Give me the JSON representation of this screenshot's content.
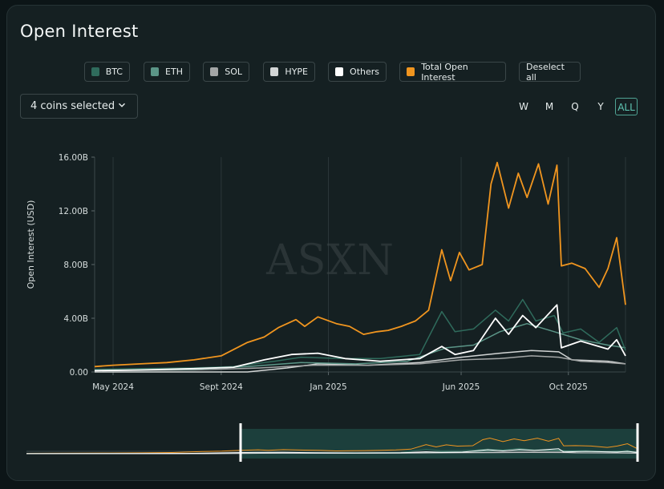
{
  "title": "Open Interest",
  "legend": [
    {
      "label": "BTC",
      "color": "#2f6b5c",
      "icon": "square-swatch"
    },
    {
      "label": "ETH",
      "color": "#5b9587",
      "icon": "square-swatch"
    },
    {
      "label": "SOL",
      "color": "#a3a6a6",
      "icon": "square-swatch"
    },
    {
      "label": "HYPE",
      "color": "#d2d5d5",
      "icon": "square-swatch"
    },
    {
      "label": "Others",
      "color": "#ffffff",
      "icon": "square-swatch"
    },
    {
      "label": "Total Open Interest",
      "color": "#f0951f",
      "icon": "square-swatch"
    }
  ],
  "deselect_label": "Deselect all",
  "coin_select": {
    "label": "4 coins selected",
    "icon": "chevron-down-icon"
  },
  "ranges": [
    "W",
    "M",
    "Q",
    "Y",
    "ALL"
  ],
  "active_range": "ALL",
  "watermark": "ASXN",
  "chart_data": {
    "type": "line",
    "ylabel": "Open Interest (USD)",
    "y_ticks": [
      "16.00B",
      "12.00B",
      "8.00B",
      "4.00B",
      "0.00"
    ],
    "ylim": [
      0,
      16
    ],
    "x_range": [
      "2024-04-10",
      "2025-12-05"
    ],
    "x_ticks": [
      {
        "date": "2024-05-01",
        "label": "May 2024"
      },
      {
        "date": "2024-09-01",
        "label": "Sept 2024"
      },
      {
        "date": "2025-01-01",
        "label": "Jan 2025"
      },
      {
        "date": "2025-06-01",
        "label": "Jun 2025"
      },
      {
        "date": "2025-10-01",
        "label": "Oct 2025"
      }
    ],
    "grid": "vertical",
    "series": [
      {
        "name": "Total Open Interest",
        "color": "#f0951f",
        "values": [
          [
            "2024-04-10",
            0.4
          ],
          [
            "2024-05-01",
            0.5
          ],
          [
            "2024-06-01",
            0.6
          ],
          [
            "2024-07-01",
            0.7
          ],
          [
            "2024-08-01",
            0.9
          ],
          [
            "2024-09-01",
            1.2
          ],
          [
            "2024-10-01",
            2.2
          ],
          [
            "2024-10-20",
            2.6
          ],
          [
            "2024-11-05",
            3.3
          ],
          [
            "2024-11-25",
            3.9
          ],
          [
            "2024-12-05",
            3.4
          ],
          [
            "2024-12-20",
            4.1
          ],
          [
            "2025-01-10",
            3.6
          ],
          [
            "2025-01-25",
            3.4
          ],
          [
            "2025-02-10",
            2.8
          ],
          [
            "2025-02-25",
            3.0
          ],
          [
            "2025-03-10",
            3.1
          ],
          [
            "2025-03-25",
            3.4
          ],
          [
            "2025-04-10",
            3.8
          ],
          [
            "2025-04-25",
            4.6
          ],
          [
            "2025-05-10",
            9.1
          ],
          [
            "2025-05-20",
            6.8
          ],
          [
            "2025-05-30",
            8.9
          ],
          [
            "2025-06-10",
            7.6
          ],
          [
            "2025-06-25",
            8.0
          ],
          [
            "2025-07-05",
            14.0
          ],
          [
            "2025-07-12",
            15.6
          ],
          [
            "2025-07-25",
            12.2
          ],
          [
            "2025-08-05",
            14.8
          ],
          [
            "2025-08-15",
            13.0
          ],
          [
            "2025-08-28",
            15.5
          ],
          [
            "2025-09-08",
            12.5
          ],
          [
            "2025-09-18",
            15.4
          ],
          [
            "2025-09-23",
            7.9
          ],
          [
            "2025-10-05",
            8.1
          ],
          [
            "2025-10-20",
            7.7
          ],
          [
            "2025-11-05",
            6.3
          ],
          [
            "2025-11-15",
            7.7
          ],
          [
            "2025-11-25",
            10.0
          ],
          [
            "2025-12-05",
            5.0
          ]
        ]
      },
      {
        "name": "BTC",
        "color": "#2f6b5c",
        "values": [
          [
            "2024-04-10",
            0.2
          ],
          [
            "2024-06-01",
            0.25
          ],
          [
            "2024-08-01",
            0.3
          ],
          [
            "2024-09-15",
            0.4
          ],
          [
            "2024-11-01",
            0.8
          ],
          [
            "2024-12-01",
            1.1
          ],
          [
            "2025-01-15",
            1.0
          ],
          [
            "2025-03-01",
            1.0
          ],
          [
            "2025-04-15",
            1.3
          ],
          [
            "2025-05-10",
            4.5
          ],
          [
            "2025-05-25",
            3.0
          ],
          [
            "2025-06-15",
            3.2
          ],
          [
            "2025-07-10",
            4.6
          ],
          [
            "2025-07-25",
            3.8
          ],
          [
            "2025-08-10",
            5.4
          ],
          [
            "2025-08-25",
            3.8
          ],
          [
            "2025-09-15",
            4.2
          ],
          [
            "2025-09-25",
            2.9
          ],
          [
            "2025-10-15",
            3.2
          ],
          [
            "2025-11-05",
            2.2
          ],
          [
            "2025-11-25",
            3.3
          ],
          [
            "2025-12-05",
            1.6
          ]
        ]
      },
      {
        "name": "ETH",
        "color": "#5b9587",
        "values": [
          [
            "2024-04-10",
            0.1
          ],
          [
            "2024-08-01",
            0.2
          ],
          [
            "2024-10-01",
            0.4
          ],
          [
            "2024-12-01",
            0.7
          ],
          [
            "2025-02-01",
            0.6
          ],
          [
            "2025-04-01",
            0.8
          ],
          [
            "2025-05-15",
            1.8
          ],
          [
            "2025-06-15",
            2.0
          ],
          [
            "2025-07-15",
            3.0
          ],
          [
            "2025-08-15",
            3.6
          ],
          [
            "2025-09-15",
            3.0
          ],
          [
            "2025-10-15",
            2.4
          ],
          [
            "2025-11-15",
            2.0
          ],
          [
            "2025-12-05",
            1.8
          ]
        ]
      },
      {
        "name": "SOL",
        "color": "#a3a6a6",
        "values": [
          [
            "2024-04-10",
            0.1
          ],
          [
            "2024-08-01",
            0.15
          ],
          [
            "2024-10-15",
            0.3
          ],
          [
            "2024-12-15",
            0.5
          ],
          [
            "2025-02-15",
            0.5
          ],
          [
            "2025-04-15",
            0.6
          ],
          [
            "2025-06-01",
            0.9
          ],
          [
            "2025-07-15",
            1.0
          ],
          [
            "2025-08-20",
            1.2
          ],
          [
            "2025-09-20",
            1.1
          ],
          [
            "2025-10-15",
            0.8
          ],
          [
            "2025-11-15",
            0.7
          ],
          [
            "2025-12-05",
            0.6
          ]
        ]
      },
      {
        "name": "HYPE",
        "color": "#d2d5d5",
        "values": [
          [
            "2024-04-10",
            0.0
          ],
          [
            "2024-10-01",
            0.0
          ],
          [
            "2024-11-15",
            0.3
          ],
          [
            "2024-12-20",
            0.6
          ],
          [
            "2025-02-15",
            0.5
          ],
          [
            "2025-04-15",
            0.7
          ],
          [
            "2025-06-01",
            1.1
          ],
          [
            "2025-07-15",
            1.4
          ],
          [
            "2025-08-20",
            1.6
          ],
          [
            "2025-09-20",
            1.5
          ],
          [
            "2025-10-05",
            0.9
          ],
          [
            "2025-11-15",
            0.8
          ],
          [
            "2025-12-05",
            0.6
          ]
        ]
      },
      {
        "name": "Others",
        "color": "#ffffff",
        "values": [
          [
            "2024-04-10",
            0.1
          ],
          [
            "2024-06-01",
            0.15
          ],
          [
            "2024-08-01",
            0.25
          ],
          [
            "2024-09-15",
            0.35
          ],
          [
            "2024-10-20",
            0.9
          ],
          [
            "2024-11-20",
            1.3
          ],
          [
            "2024-12-20",
            1.4
          ],
          [
            "2025-01-20",
            1.0
          ],
          [
            "2025-03-01",
            0.8
          ],
          [
            "2025-04-15",
            1.0
          ],
          [
            "2025-05-10",
            1.9
          ],
          [
            "2025-05-25",
            1.3
          ],
          [
            "2025-06-15",
            1.6
          ],
          [
            "2025-07-10",
            4.0
          ],
          [
            "2025-07-25",
            2.8
          ],
          [
            "2025-08-10",
            4.2
          ],
          [
            "2025-08-25",
            3.3
          ],
          [
            "2025-09-18",
            5.0
          ],
          [
            "2025-09-23",
            1.8
          ],
          [
            "2025-10-15",
            2.3
          ],
          [
            "2025-11-15",
            1.7
          ],
          [
            "2025-11-25",
            2.4
          ],
          [
            "2025-12-05",
            1.2
          ]
        ]
      }
    ]
  }
}
